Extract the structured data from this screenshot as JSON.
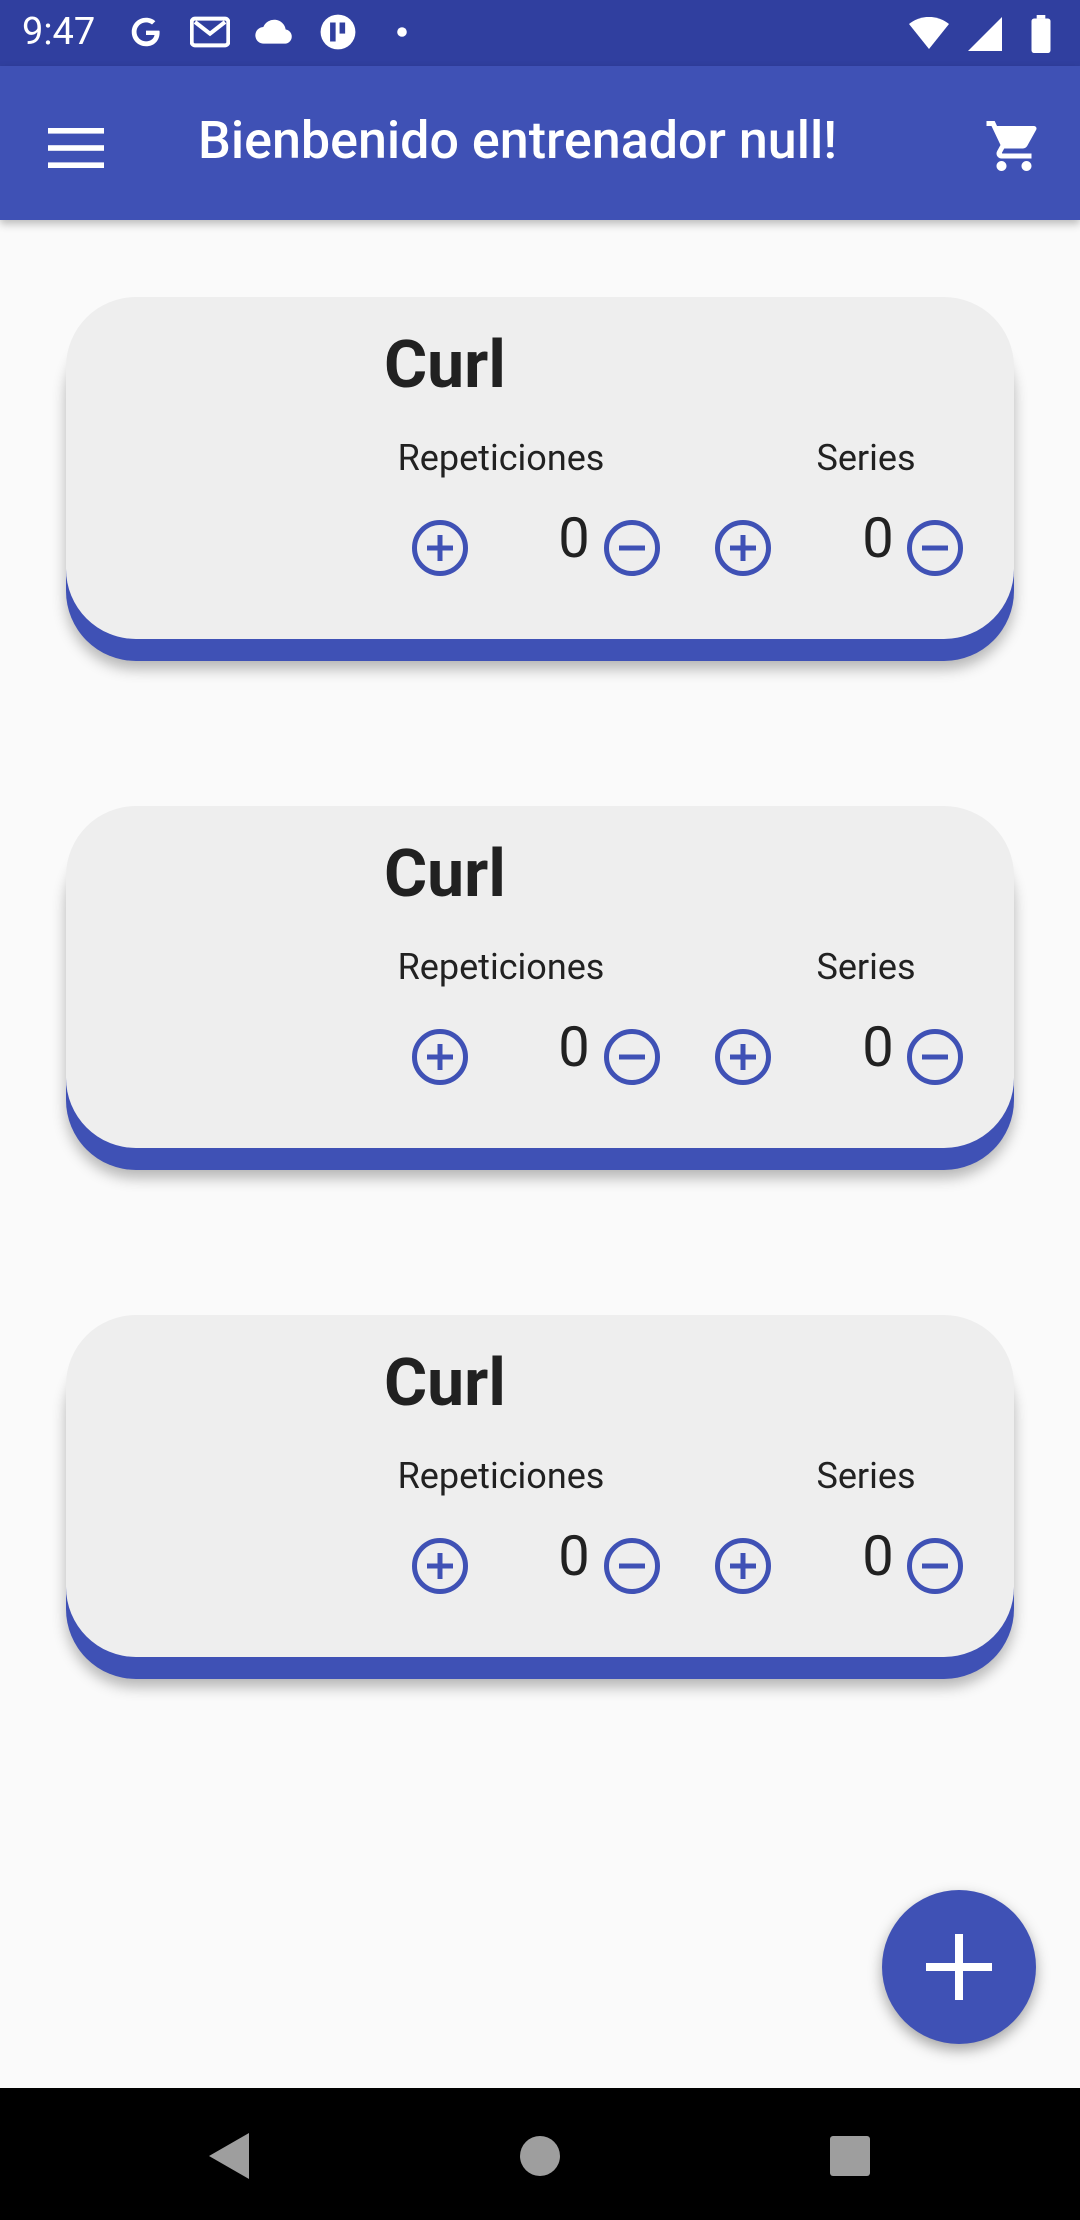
{
  "status_bar": {
    "time": "9:47",
    "left_icons": [
      "google-icon",
      "gmail-icon",
      "cloud-icon",
      "app-icon",
      "dot-icon"
    ],
    "right_icons": [
      "wifi-icon",
      "signal-icon",
      "battery-icon"
    ]
  },
  "app_bar": {
    "title": "Bienbenido entrenador null!",
    "menu_icon": "menu-icon",
    "cart_icon": "cart-icon",
    "color": "#3f51b5"
  },
  "cards": [
    {
      "title": "Curl",
      "repeticiones_label": "Repeticiones",
      "series_label": "Series",
      "repeticiones": "0",
      "series": "0"
    },
    {
      "title": "Curl",
      "repeticiones_label": "Repeticiones",
      "series_label": "Series",
      "repeticiones": "0",
      "series": "0"
    },
    {
      "title": "Curl",
      "repeticiones_label": "Repeticiones",
      "series_label": "Series",
      "repeticiones": "0",
      "series": "0"
    }
  ],
  "fab": {
    "icon": "plus-icon"
  },
  "nav_bar": {
    "icons": [
      "back-icon",
      "home-icon",
      "recents-icon"
    ]
  },
  "colors": {
    "primary": "#3f51b5",
    "primary_dark": "#303f9f",
    "card_bg": "#eeeeee",
    "background": "#fafafa"
  }
}
